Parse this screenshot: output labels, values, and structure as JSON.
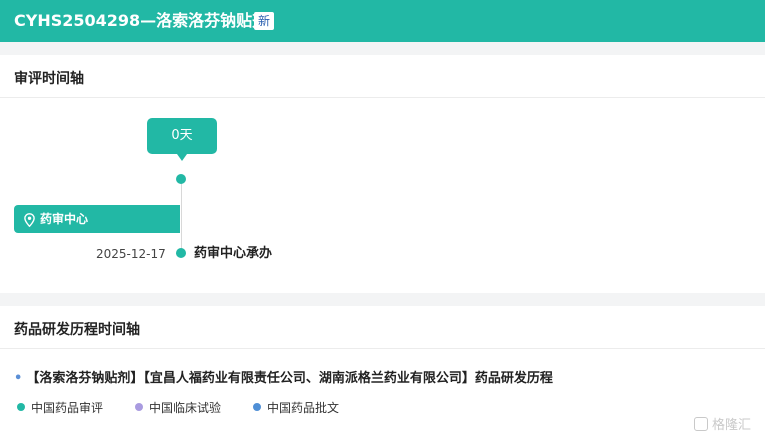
{
  "header": {
    "title": "CYHS2504298—洛索洛芬钠贴剂",
    "badge": "新"
  },
  "review_timeline": {
    "title": "审评时间轴",
    "days_bubble": "0天",
    "org_tag": "药审中心",
    "events": [
      {
        "date": "2025-12-17",
        "label": "药审中心承办"
      }
    ]
  },
  "rd_timeline": {
    "title": "药品研发历程时间轴",
    "history_line": "【洛索洛芬钠贴剂】【宜昌人福药业有限责任公司、湖南派格兰药业有限公司】药品研发历程",
    "bullet": "•",
    "legend": [
      {
        "label": "中国药品审评",
        "color": "#22b8a5"
      },
      {
        "label": "中国临床试验",
        "color": "#a99be0"
      },
      {
        "label": "中国药品批文",
        "color": "#4f8fd6"
      }
    ]
  },
  "colors": {
    "accent": "#22b8a5",
    "badge_text": "#2a5fb0"
  },
  "watermark": {
    "text": "格隆汇",
    "icon": "gelonghui-logo-icon"
  }
}
